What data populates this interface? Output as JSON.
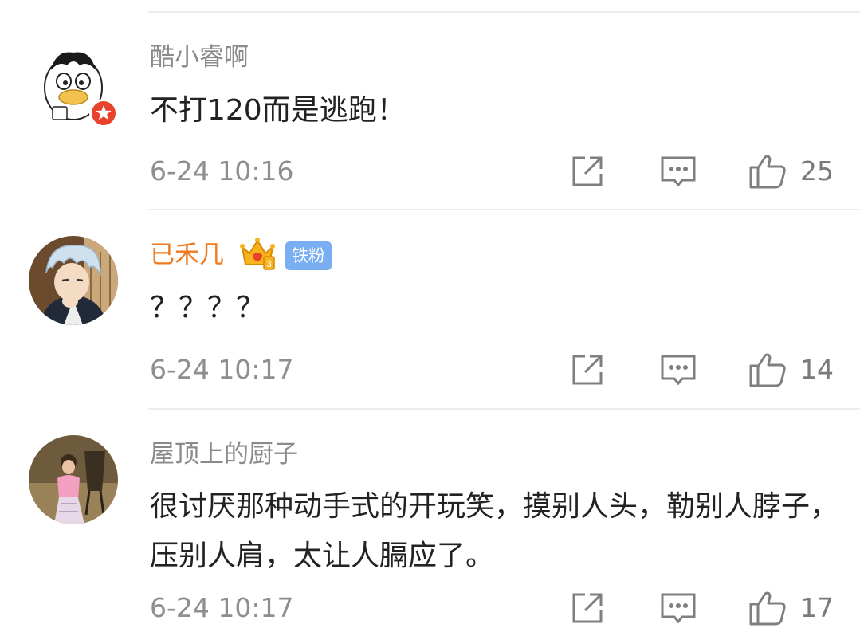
{
  "comments": [
    {
      "username": "酷小睿啊",
      "text": "不打120而是逃跑！",
      "time": "6-24 10:16",
      "likes": "25",
      "verified": true
    },
    {
      "username": "已禾几",
      "fan_badge": "铁粉",
      "text": "？？？？",
      "time": "6-24 10:17",
      "likes": "14",
      "vip_crown_level": "3"
    },
    {
      "username": "屋顶上的厨子",
      "text": "很讨厌那种动手式的开玩笑，摸别人头，勒别人脖子，压别人肩，太让人膈应了。",
      "time": "6-24 10:17",
      "likes": "17"
    }
  ],
  "icons": {
    "share": "share-icon",
    "reply": "comment-icon",
    "like": "thumbs-up-icon",
    "verified": "verified-badge-icon",
    "crown": "vip-crown-icon"
  },
  "colors": {
    "username": "#8a8a8a",
    "vip_username": "#f07a1f",
    "fan_badge": "#7aaef2",
    "verified_badge": "#e8412c",
    "meta": "#8e8e8e",
    "divider": "#ececec"
  }
}
